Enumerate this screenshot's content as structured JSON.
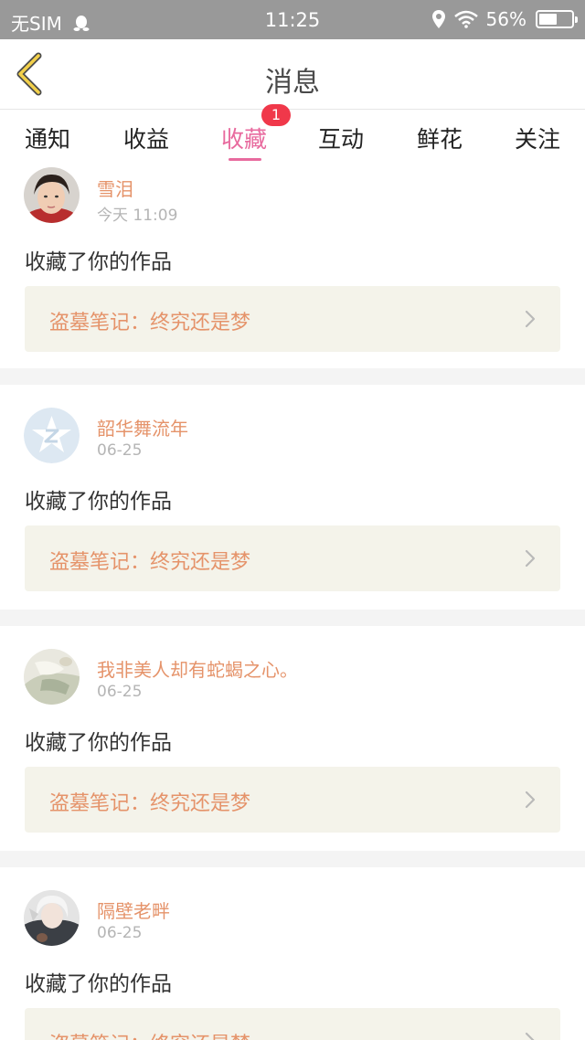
{
  "status_bar": {
    "carrier": "无SIM",
    "time": "11:25",
    "battery": "56%",
    "battery_level": 0.56
  },
  "nav": {
    "title": "消息"
  },
  "tabs": [
    {
      "label": "通知"
    },
    {
      "label": "收益"
    },
    {
      "label": "收藏",
      "badge": "1"
    },
    {
      "label": "互动"
    },
    {
      "label": "鲜花"
    },
    {
      "label": "关注"
    }
  ],
  "active_tab": "收藏",
  "messages": [
    {
      "user": "雪泪",
      "time": "今天 11:09",
      "action": "收藏了你的作品",
      "work": "盗墓笔记：终究还是梦"
    },
    {
      "user": "韶华舞流年",
      "time": "06-25",
      "action": "收藏了你的作品",
      "work": "盗墓笔记：终究还是梦"
    },
    {
      "user": "我非美人却有蛇蝎之心。",
      "time": "06-25",
      "action": "收藏了你的作品",
      "work": "盗墓笔记：终究还是梦"
    },
    {
      "user": "隔壁老畔",
      "time": "06-25",
      "action": "收藏了你的作品",
      "work": "盗墓笔记：终究还是梦"
    }
  ],
  "colors": {
    "accent": "#e86a9e",
    "badge": "#f0384a",
    "username": "#e5936a",
    "back_arrow": "#f2d04a",
    "status_bar": "#999999"
  },
  "icons": {
    "back": "chevron-left-icon",
    "qq": "qq-penguin-icon",
    "location": "location-pin-icon",
    "wifi": "wifi-icon",
    "battery": "battery-icon",
    "chevron": "chevron-right-icon"
  }
}
